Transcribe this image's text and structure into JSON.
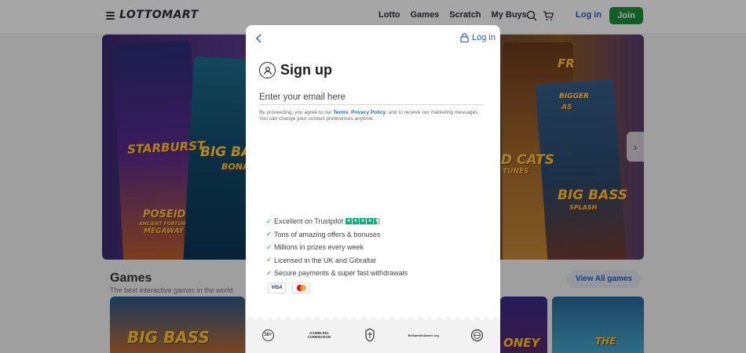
{
  "header": {
    "logo": "LOTTOMART",
    "nav": [
      "Lotto",
      "Games",
      "Scratch",
      "My Buys"
    ],
    "login": "Log in",
    "join": "Join"
  },
  "hero": {
    "texts": [
      "STARBURST",
      "BIG BAS",
      "BONAN",
      "POSEID",
      "ANCIENT FORTUN",
      "MEGAWAY",
      "FR",
      "BIGGER",
      "AS",
      "D CATS",
      "TUNES",
      "BIG BASS",
      "SPLASH"
    ]
  },
  "games": {
    "title": "Games",
    "subtitle": "The best interactive games in the world",
    "view_all": "View All games",
    "cards": [
      "BIG BASS",
      "ONEY",
      "THE"
    ]
  },
  "modal": {
    "login": "Log in",
    "title": "Sign up",
    "email_placeholder": "Enter your email here",
    "consent_pre": "By proceeding, you agree to our ",
    "consent_terms": "Terms",
    "consent_sep": ", ",
    "consent_privacy": "Privacy Policy",
    "consent_post": ", and to receive our marketing messages. You can change your contact preferences anytime.",
    "benefits": [
      "Excellent on Trustpilot",
      "Tons of amazing offers & bonuses",
      "Millions in prizes every week",
      "Licensed in the UK and Gibraltar",
      "Secure payments & super fast withdrawals"
    ],
    "trustpilot_rating": 4.5,
    "payments": [
      "VISA",
      "mastercard"
    ],
    "regulators": [
      "18+",
      "GAMBLING COMMISSION",
      "crest",
      "BeGambleAware.org",
      "seal"
    ]
  },
  "colors": {
    "brand_blue": "#2563c4",
    "join_green": "#1e8f3c",
    "check_green": "#2ca84a",
    "trustpilot_green": "#00b67a"
  }
}
